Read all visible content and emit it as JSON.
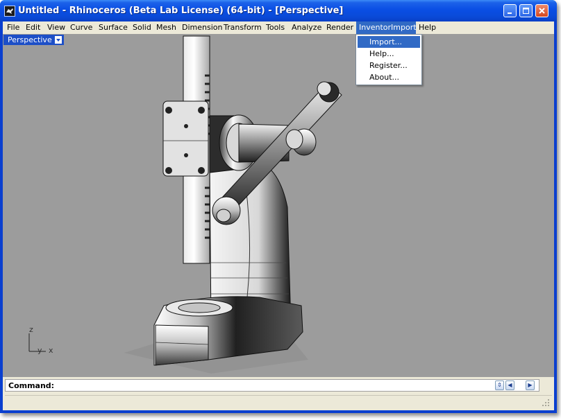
{
  "window": {
    "title": "Untitled - Rhinoceros (Beta Lab License) (64-bit) - [Perspective]",
    "controls": [
      "minimize",
      "maximize",
      "close"
    ]
  },
  "menubar": {
    "items": [
      {
        "label": "File"
      },
      {
        "label": "Edit"
      },
      {
        "label": "View"
      },
      {
        "label": "Curve"
      },
      {
        "label": "Surface"
      },
      {
        "label": "Solid"
      },
      {
        "label": "Mesh"
      },
      {
        "label": "Dimension"
      },
      {
        "label": "Transform"
      },
      {
        "label": "Tools"
      },
      {
        "label": "Analyze"
      },
      {
        "label": "Render"
      },
      {
        "label": "InventorImport",
        "active": true
      },
      {
        "label": "Help"
      }
    ]
  },
  "dropdown": {
    "items": [
      {
        "label": "Import...",
        "selected": true
      },
      {
        "label": "Help..."
      },
      {
        "label": "Register..."
      },
      {
        "label": "About..."
      }
    ]
  },
  "viewport": {
    "name": "Perspective",
    "axes": {
      "z": "z",
      "y": "y",
      "x": "x"
    },
    "background": "#9c9c9c"
  },
  "command": {
    "label": "Command:",
    "value": ""
  },
  "colors": {
    "titlebar": "#0a4ee4",
    "menu_highlight": "#316ac5",
    "chrome": "#ece9d8"
  }
}
